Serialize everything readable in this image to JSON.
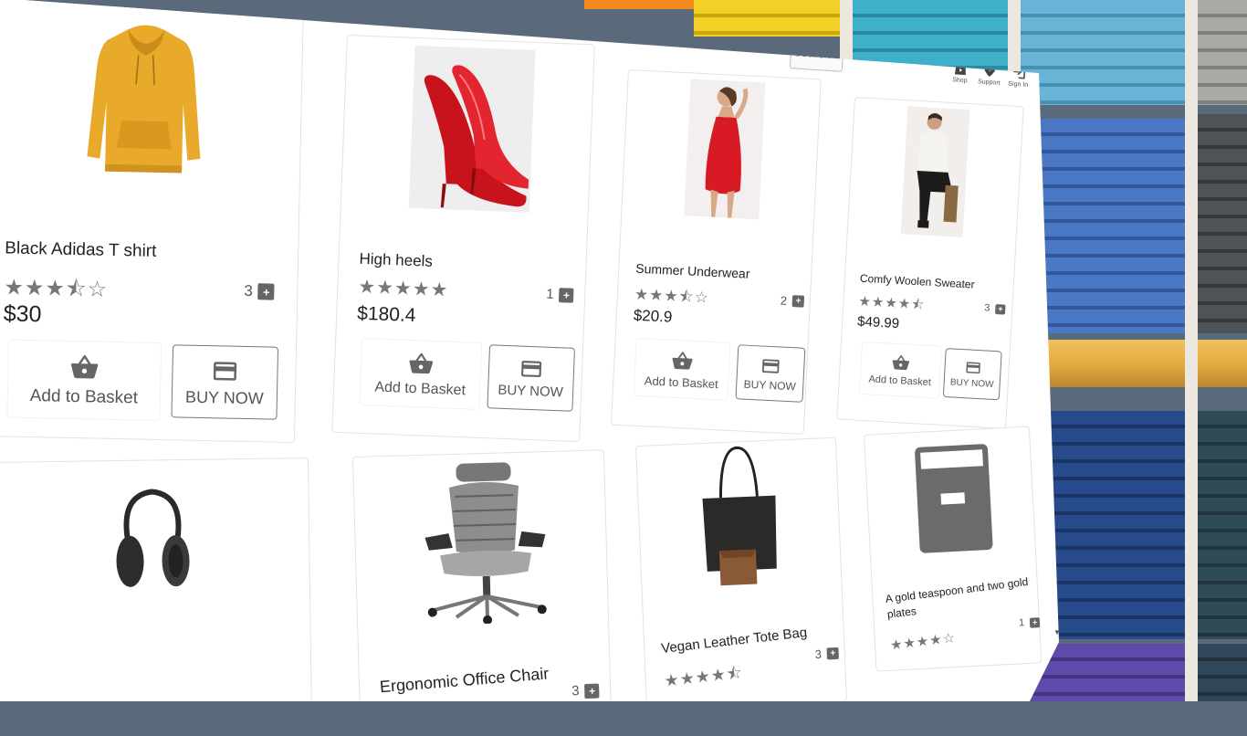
{
  "header": {
    "search_placeholder": "Search",
    "nav": [
      {
        "label": "Shop",
        "icon": "shopping-bag-icon"
      },
      {
        "label": "Support",
        "icon": "help-icon"
      },
      {
        "label": "Sign In",
        "icon": "sign-in-icon"
      }
    ]
  },
  "labels": {
    "add_to_basket": "Add to Basket",
    "buy_now": "BUY NOW"
  },
  "products": [
    {
      "title": "Black Adidas T shirt",
      "rating": "★★★⯪☆",
      "reviews": "3",
      "price": "$30",
      "image": "mustard-hoodie"
    },
    {
      "title": "High heels",
      "rating": "★★★★★",
      "reviews": "1",
      "price": "$180.4",
      "image": "red-stiletto-heels"
    },
    {
      "title": "Summer Underwear",
      "rating": "★★★⯪☆",
      "reviews": "2",
      "price": "$20.9",
      "image": "red-slip-dress-model"
    },
    {
      "title": "Comfy Woolen Sweater",
      "rating": "★★★★⯪",
      "reviews": "3",
      "price": "$49.99",
      "image": "white-sweater-model"
    },
    {
      "title": "",
      "rating": "",
      "reviews": "",
      "price": "",
      "image": "black-headphones"
    },
    {
      "title": "Ergonomic Office Chair",
      "rating": "",
      "reviews": "3",
      "price": "",
      "image": "mesh-office-chair"
    },
    {
      "title": "Vegan Leather Tote Bag",
      "rating": "★★★★⯪",
      "reviews": "3",
      "price": "",
      "image": "black-tote-bag"
    },
    {
      "title": "A gold teaspoon and two gold plates",
      "rating": "★★★★☆",
      "reviews": "1",
      "price": "",
      "image": "placeholder-image"
    }
  ],
  "colors": {
    "icon_gray": "#666666",
    "hoodie": "#e9a92b",
    "heels": "#c8131d",
    "background_shelf": "#e3a93f"
  }
}
